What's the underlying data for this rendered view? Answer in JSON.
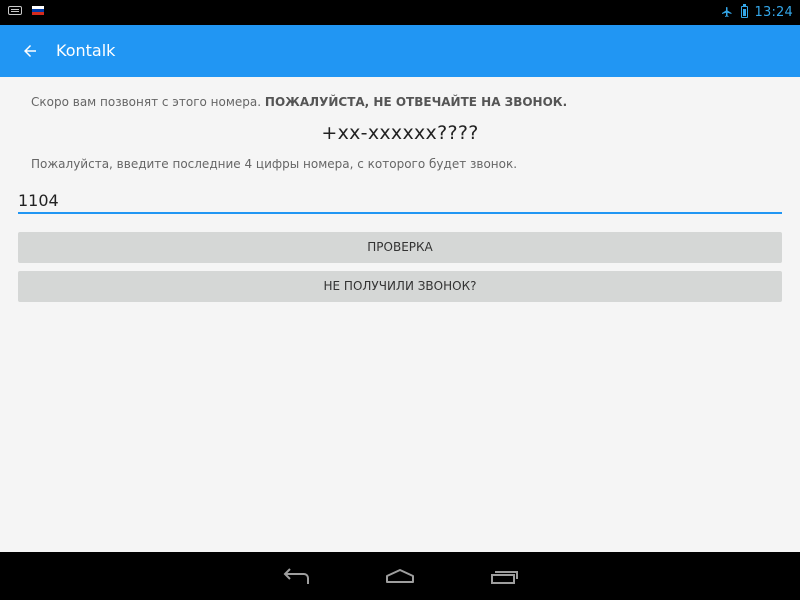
{
  "status_bar": {
    "time": "13:24",
    "icons": [
      "keyboard-icon",
      "russian-flag-icon",
      "airplane-mode-icon",
      "battery-icon"
    ],
    "accent_color": "#34a6e8"
  },
  "app_bar": {
    "title": "Kontalk",
    "back_icon": "arrow-left-icon",
    "background_color": "#2196f3"
  },
  "main": {
    "info_text": "Скоро вам позвонят с этого номера.",
    "info_bold": "ПОЖАЛУЙСТА, НЕ ОТВЕЧАЙТЕ НА ЗВОНОК.",
    "phone_number": "+xx-xxxxxx????",
    "hint_text": "Пожалуйста, введите последние 4 цифры номера, с которого будет звонок.",
    "code_value": "1104",
    "verify_button": "ПРОВЕРКА",
    "no_call_button": "НЕ ПОЛУЧИЛИ ЗВОНОК?"
  },
  "nav_bar": {
    "icons": [
      "back-icon",
      "home-icon",
      "recent-apps-icon"
    ]
  }
}
